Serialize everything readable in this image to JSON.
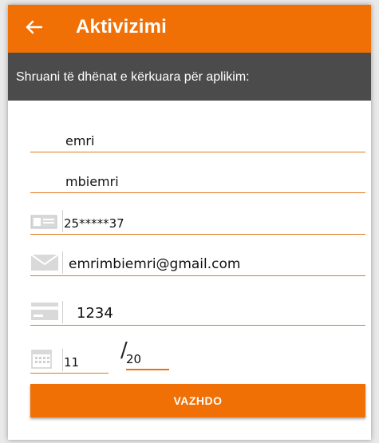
{
  "app_bar": {
    "title": "Aktivizimi",
    "back_icon": "arrow-left-icon",
    "color": "#f07005"
  },
  "subheader": {
    "text": "Shruani të dhënat e kërkuara për aplikim:",
    "color": "#4b4b4b"
  },
  "form": {
    "first_name": {
      "value": "emri"
    },
    "last_name": {
      "value": "mbiemri"
    },
    "id_number": {
      "value": "25*****37",
      "icon": "id-card-icon"
    },
    "email": {
      "value": "emrimbiemri@gmail.com",
      "icon": "envelope-icon"
    },
    "card": {
      "value": "1234",
      "icon": "credit-card-icon"
    },
    "expiry": {
      "month": "11",
      "separator": "/",
      "year": "20",
      "icon": "calendar-icon"
    }
  },
  "submit_button": {
    "label": "VAZHDO"
  },
  "accent_color": "#e07a1c"
}
